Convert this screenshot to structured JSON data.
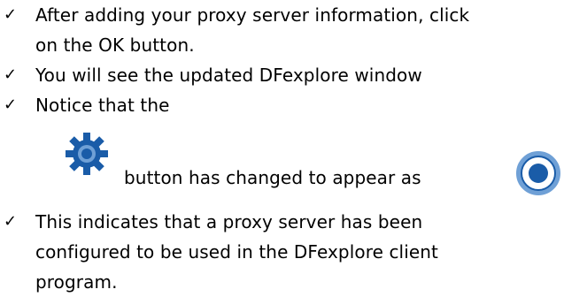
{
  "bullets": [
    {
      "mark": "✓",
      "line1": "After adding your proxy server information, click",
      "line2": "on the OK button."
    },
    {
      "mark": "✓",
      "line1": "You will see the updated DFexplore window"
    },
    {
      "mark": "✓",
      "line1": "Notice that the"
    },
    {
      "mark": "✓",
      "line1": "This indicates that a proxy server has been",
      "line2": "configured to be used in the DFexplore client",
      "line3": "program."
    }
  ],
  "icon_row": {
    "text": "button has changed to appear as",
    "before_icon": "gear-icon",
    "after_icon": "radio-target-icon"
  },
  "colors": {
    "icon_blue": "#1a5ca8",
    "icon_blue_light": "#6fa0d6",
    "text": "#000000",
    "background": "#ffffff"
  }
}
